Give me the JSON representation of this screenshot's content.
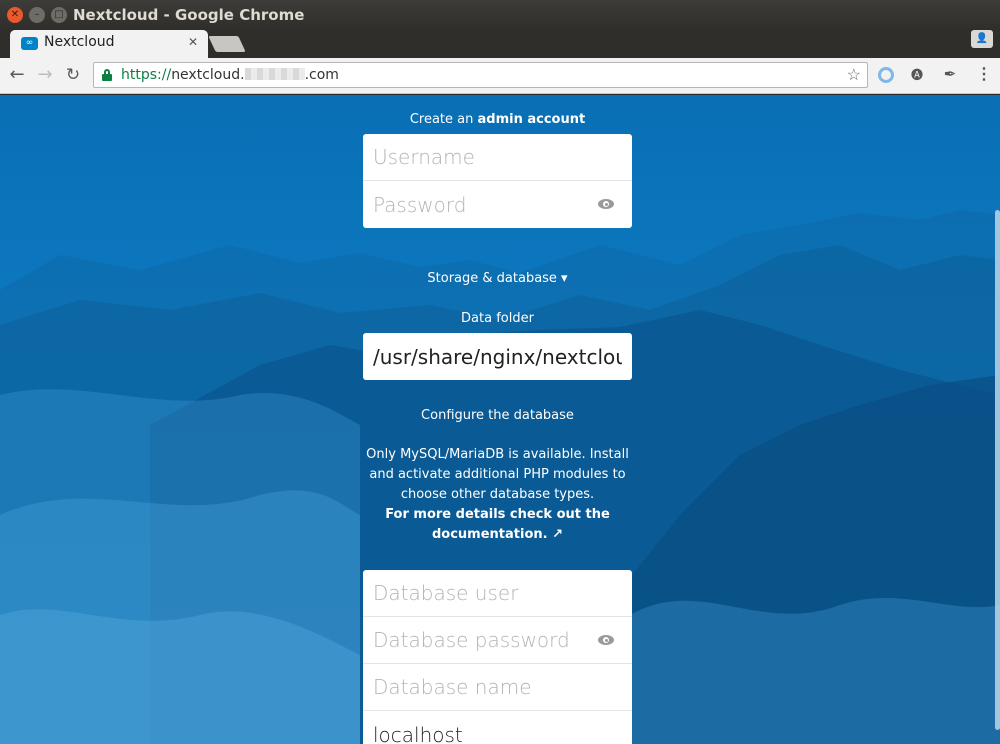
{
  "window": {
    "title": "Nextcloud - Google Chrome",
    "close_glyph": "✕",
    "min_glyph": "–",
    "max_glyph": "□"
  },
  "tab": {
    "title": "Nextcloud",
    "favicon": "nextcloud-logo",
    "close_glyph": "✕"
  },
  "toolbar": {
    "back_glyph": "←",
    "forward_glyph": "→",
    "reload_glyph": "↻",
    "url_scheme": "https://",
    "url_host_prefix": "nextcloud.",
    "url_host_suffix": ".com",
    "star_glyph": "☆",
    "menu_glyph": "⋮"
  },
  "setup": {
    "admin_heading_prefix": "Create an ",
    "admin_heading_bold": "admin account",
    "username_placeholder": "Username",
    "password_placeholder": "Password",
    "storage_toggle": "Storage & database ▾",
    "data_folder_label": "Data folder",
    "data_folder_value": "/usr/share/nginx/nextcloud-data",
    "configure_db_label": "Configure the database",
    "db_info_line1": "Only MySQL/MariaDB is available. Install and activate additional PHP modules to choose other database types.",
    "db_info_link": "For more details check out the documentation. ↗",
    "db_user_placeholder": "Database user",
    "db_password_placeholder": "Database password",
    "db_name_placeholder": "Database name",
    "db_host_value": "localhost"
  },
  "colors": {
    "brand": "#0082c9",
    "secure": "#0b8043"
  }
}
